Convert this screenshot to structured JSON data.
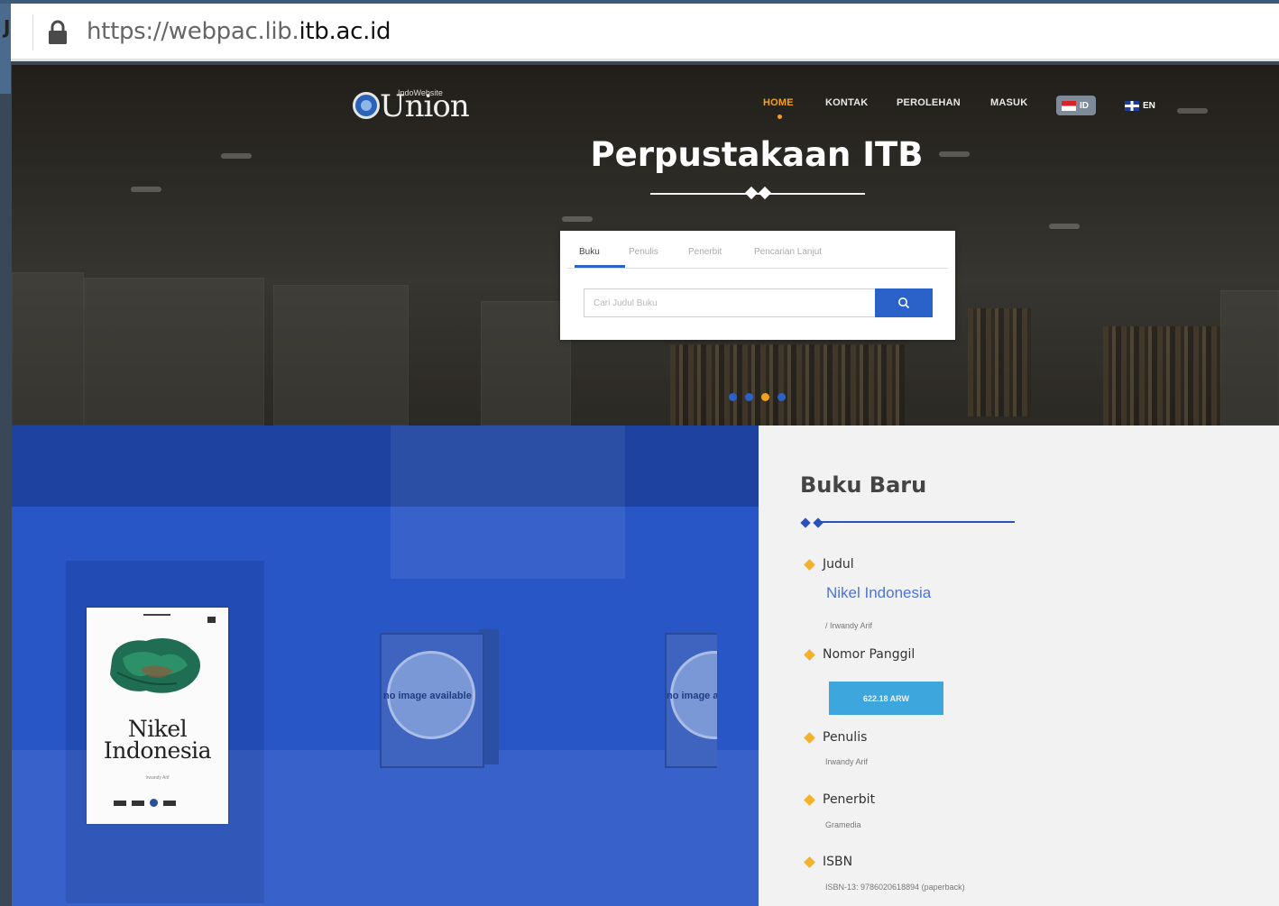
{
  "browser": {
    "url_prefix": "https://webpac.lib.",
    "url_domain": "itb.ac.id",
    "left_glyph": "J"
  },
  "header": {
    "logo_text": "Union",
    "logo_small": "IndoWebsite",
    "nav": [
      "HOME",
      "KONTAK",
      "PEROLEHAN",
      "MASUK"
    ],
    "lang_id": "ID",
    "lang_en": "EN",
    "title": "Perpustakaan ITB"
  },
  "search": {
    "tabs": [
      "Buku",
      "Penulis",
      "Penerbit",
      "Pencarian Lanjut"
    ],
    "placeholder": "Cari Judul Buku",
    "button_icon": "search-icon"
  },
  "slider": {
    "count": 4,
    "active_index": 2
  },
  "featured_book": {
    "cover_title_line1": "Nikel",
    "cover_title_line2": "Indonesia",
    "cover_author": "Irwandy Arif"
  },
  "details": {
    "heading": "Buku Baru",
    "judul_label": "Judul",
    "judul_value": "Nikel Indonesia",
    "judul_author": "/ Irwandy Arif",
    "nomor_label": "Nomor Panggil",
    "nomor_value": "622.18 ARW",
    "penulis_label": "Penulis",
    "penulis_value": "Irwandy Arif",
    "penerbit_label": "Penerbit",
    "penerbit_value": "Gramedia",
    "isbn_label": "ISBN",
    "isbn_value": "ISBN-13: 9786020618894 (paperback)"
  },
  "placeholders": {
    "caption": "no image available"
  },
  "colors": {
    "accent": "#2a62c9",
    "highlight": "#f3a21e",
    "call_number_bg": "#3da6dd"
  }
}
